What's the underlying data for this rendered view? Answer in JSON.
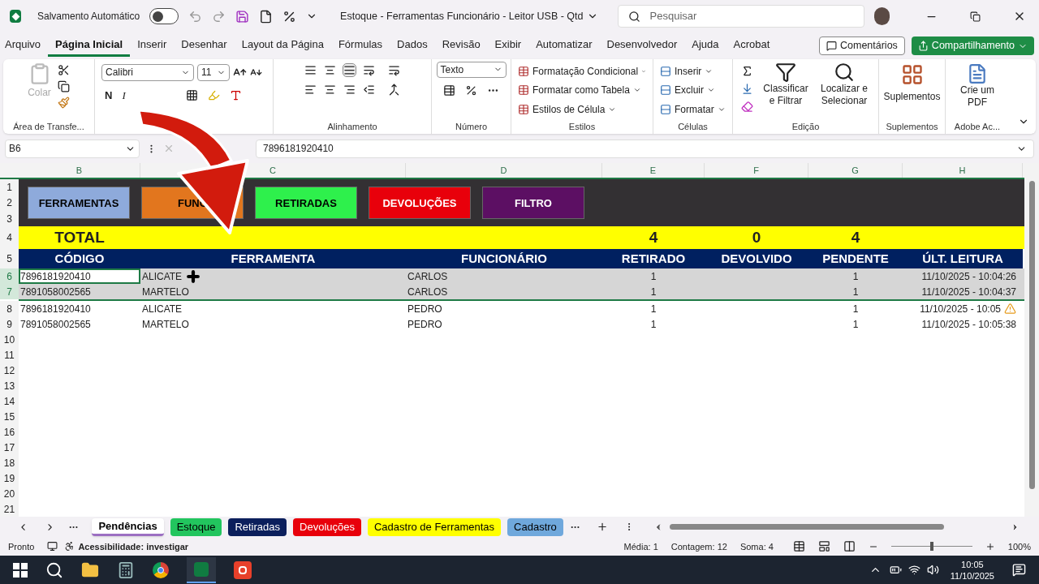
{
  "title_bar": {
    "autosave_label": "Salvamento Automático",
    "autosave_on": false,
    "title": "Estoque - Ferramentas Funcionário - Leitor USB - Qtd",
    "search_placeholder": "Pesquisar"
  },
  "menu_tabs": [
    {
      "label": "Arquivo",
      "selected": false
    },
    {
      "label": "Página Inicial",
      "selected": true
    },
    {
      "label": "Inserir",
      "selected": false
    },
    {
      "label": "Desenhar",
      "selected": false
    },
    {
      "label": "Layout da Página",
      "selected": false
    },
    {
      "label": "Fórmulas",
      "selected": false
    },
    {
      "label": "Dados",
      "selected": false
    },
    {
      "label": "Revisão",
      "selected": false
    },
    {
      "label": "Exibir",
      "selected": false
    },
    {
      "label": "Automatizar",
      "selected": false
    },
    {
      "label": "Desenvolvedor",
      "selected": false
    },
    {
      "label": "Ajuda",
      "selected": false
    },
    {
      "label": "Acrobat",
      "selected": false
    }
  ],
  "comments_button": "Comentários",
  "share_button": "Compartilhamento",
  "ribbon": {
    "clipboard": {
      "paste": "Colar",
      "label": "Área de Transfe..."
    },
    "font": {
      "name": "Calibri",
      "size": "11",
      "bold": "N",
      "italic": "I"
    },
    "alignment": {
      "label": "Alinhamento"
    },
    "number": {
      "format": "Texto",
      "label": "Número"
    },
    "styles": {
      "items": [
        "Formatação Condicional",
        "Formatar como Tabela",
        "Estilos de Célula"
      ],
      "label": "Estilos"
    },
    "cells": {
      "items": [
        "Inserir",
        "Excluir",
        "Formatar"
      ],
      "label": "Células"
    },
    "editing": {
      "sort": "Classificar e Filtrar",
      "find": "Localizar e Selecionar",
      "label": "Edição"
    },
    "addins": {
      "button": "Suplementos",
      "label": "Suplementos"
    },
    "adobe": {
      "button": "Crie um PDF",
      "label": "Adobe Ac..."
    }
  },
  "formula_bar": {
    "name_box": "B6",
    "value": "7896181920410"
  },
  "columns": [
    "B",
    "C",
    "D",
    "E",
    "F",
    "G",
    "H"
  ],
  "top_row_numbers": [
    "1",
    "2",
    "3"
  ],
  "nav_buttons": [
    {
      "label": "FERRAMENTAS",
      "color": "#8eaadb"
    },
    {
      "label": "FUNC",
      "color": "#e2761e"
    },
    {
      "label": "RETIRADAS",
      "color": "#2ef04c"
    },
    {
      "label": "DEVOLUÇÕES",
      "color": "#e8000b"
    },
    {
      "label": "FILTRO",
      "color": "#5c0f63"
    }
  ],
  "total": {
    "row": "4",
    "label": "TOTAL",
    "retirado": "4",
    "devolvido": "0",
    "pendente": "4"
  },
  "header": {
    "row": "5",
    "cells": [
      "CÓDIGO",
      "FERRAMENTA",
      "FUNCIONÁRIO",
      "RETIRADO",
      "DEVOLVIDO",
      "PENDENTE",
      "ÚLT. LEITURA"
    ]
  },
  "rows": [
    {
      "number": "6",
      "codigo": "7896181920410",
      "ferramenta": "ALICATE",
      "funcionario": "CARLOS",
      "retirado": "1",
      "pendente": "1",
      "leitura": "11/10/2025 - 10:04:26",
      "selected": true,
      "active": true,
      "warning": false
    },
    {
      "number": "7",
      "codigo": "7891058002565",
      "ferramenta": "MARTELO",
      "funcionario": "CARLOS",
      "retirado": "1",
      "pendente": "1",
      "leitura": "11/10/2025 - 10:04:37",
      "selected": true,
      "active": false,
      "warning": false
    },
    {
      "number": "8",
      "codigo": "7896181920410",
      "ferramenta": "ALICATE",
      "funcionario": "PEDRO",
      "retirado": "1",
      "pendente": "1",
      "leitura": "11/10/2025 - 10:05",
      "selected": false,
      "active": false,
      "warning": true
    },
    {
      "number": "9",
      "codigo": "7891058002565",
      "ferramenta": "MARTELO",
      "funcionario": "PEDRO",
      "retirado": "1",
      "pendente": "1",
      "leitura": "11/10/2025 - 10:05:38",
      "selected": false,
      "active": false,
      "warning": false
    }
  ],
  "empty_row_numbers": [
    "10",
    "11",
    "12",
    "13",
    "14",
    "15",
    "16",
    "17",
    "18",
    "19",
    "20",
    "21"
  ],
  "sheet_tabs": [
    {
      "label": "Pendências",
      "color": "#ffffff",
      "selected": true
    },
    {
      "label": "Estoque",
      "color": "#22c55e",
      "selected": false
    },
    {
      "label": "Retiradas",
      "color": "#0b1f5c",
      "selected": false
    },
    {
      "label": "Devoluções",
      "color": "#e8000b",
      "selected": false
    },
    {
      "label": "Cadastro de Ferramentas",
      "color": "#ffff00",
      "selected": false
    },
    {
      "label": "Cadastro",
      "color": "#6fa8dc",
      "selected": false
    }
  ],
  "status_bar": {
    "ready": "Pronto",
    "accessibility": "Acessibilidade: investigar",
    "average": "Média: 1",
    "count": "Contagem: 12",
    "sum": "Soma: 4",
    "zoom": "100%",
    "level": 0.5
  },
  "taskbar": {
    "time": "10:05",
    "date": "11/10/2025"
  }
}
